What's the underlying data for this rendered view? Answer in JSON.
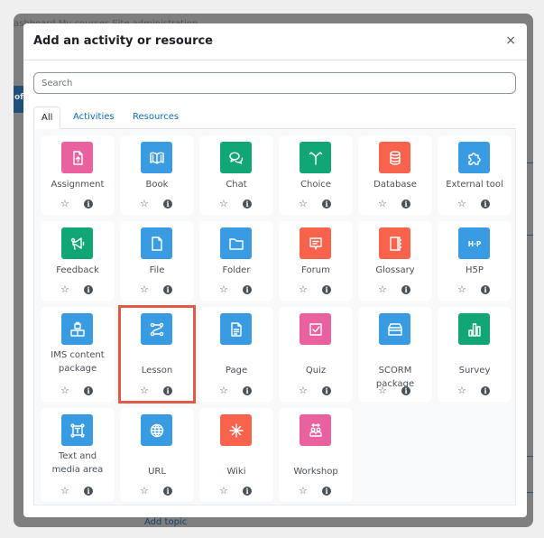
{
  "background": {
    "nav_text": "ashboard   My courses   Site administration",
    "side_text": "of",
    "footer_link": "Add topic"
  },
  "modal": {
    "title": "Add an activity or resource",
    "close_label": "×",
    "search_placeholder": "Search",
    "search_value": "",
    "tabs": [
      {
        "label": "All",
        "active": true
      },
      {
        "label": "Activities",
        "active": false
      },
      {
        "label": "Resources",
        "active": false
      }
    ],
    "highlighted_item": "Lesson",
    "colors": {
      "pink": "#e9629f",
      "blue": "#399be2",
      "green": "#11a676",
      "orange": "#f7634d",
      "highlight": "#e05a46"
    },
    "items": [
      {
        "label": "Assignment",
        "icon": "assignment-icon",
        "color": "pink"
      },
      {
        "label": "Book",
        "icon": "book-icon",
        "color": "blue"
      },
      {
        "label": "Chat",
        "icon": "chat-icon",
        "color": "green"
      },
      {
        "label": "Choice",
        "icon": "choice-icon",
        "color": "green"
      },
      {
        "label": "Database",
        "icon": "database-icon",
        "color": "orange"
      },
      {
        "label": "External tool",
        "icon": "puzzle-icon",
        "color": "blue"
      },
      {
        "label": "Feedback",
        "icon": "megaphone-icon",
        "color": "green"
      },
      {
        "label": "File",
        "icon": "file-icon",
        "color": "blue"
      },
      {
        "label": "Folder",
        "icon": "folder-icon",
        "color": "blue"
      },
      {
        "label": "Forum",
        "icon": "forum-icon",
        "color": "orange"
      },
      {
        "label": "Glossary",
        "icon": "glossary-icon",
        "color": "orange"
      },
      {
        "label": "H5P",
        "icon": "h5p-icon",
        "color": "blue"
      },
      {
        "label": "IMS content package",
        "icon": "ims-package-icon",
        "color": "blue"
      },
      {
        "label": "Lesson",
        "icon": "lesson-icon",
        "color": "blue"
      },
      {
        "label": "Page",
        "icon": "page-icon",
        "color": "blue"
      },
      {
        "label": "Quiz",
        "icon": "quiz-icon",
        "color": "pink"
      },
      {
        "label": "SCORM package",
        "icon": "scorm-icon",
        "color": "blue"
      },
      {
        "label": "Survey",
        "icon": "survey-icon",
        "color": "green"
      },
      {
        "label": "Text and media area",
        "icon": "text-media-icon",
        "color": "blue"
      },
      {
        "label": "URL",
        "icon": "globe-icon",
        "color": "blue"
      },
      {
        "label": "Wiki",
        "icon": "wiki-icon",
        "color": "orange"
      },
      {
        "label": "Workshop",
        "icon": "workshop-icon",
        "color": "pink"
      }
    ],
    "star_glyph": "☆",
    "info_glyph": "i"
  }
}
